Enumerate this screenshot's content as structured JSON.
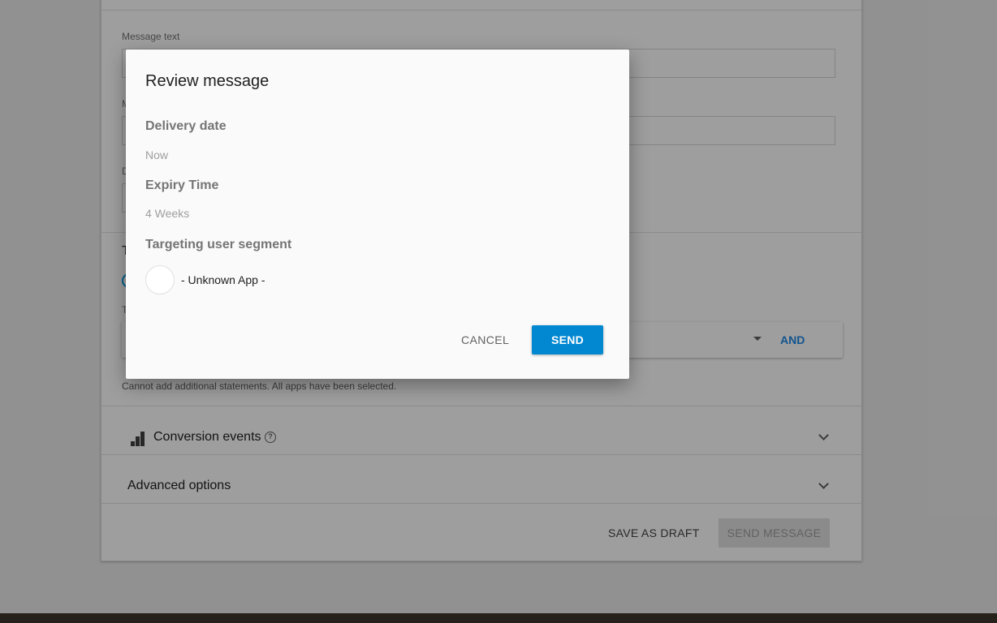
{
  "form": {
    "message_text_label": "Message text",
    "message_title_label_partial": "M",
    "delivery_label_partial": "D",
    "target_section_partial": "T",
    "target_label_partial": "T",
    "and_button": "AND",
    "hint": "Cannot add additional statements. All apps have been selected.",
    "conversion_events": "Conversion events",
    "conversion_help": "?",
    "advanced_options": "Advanced options",
    "save_as_draft": "SAVE AS DRAFT",
    "send_message": "SEND MESSAGE"
  },
  "dialog": {
    "title": "Review message",
    "delivery_heading": "Delivery date",
    "delivery_value": "Now",
    "expiry_heading": "Expiry Time",
    "expiry_value": "4 Weeks",
    "segment_heading": "Targeting user segment",
    "app_name": "- Unknown App -",
    "cancel": "CANCEL",
    "send": "SEND"
  },
  "colors": {
    "primary": "#0288d1",
    "link": "#1e88e5",
    "overlay": "rgba(0,0,0,0.38)"
  }
}
